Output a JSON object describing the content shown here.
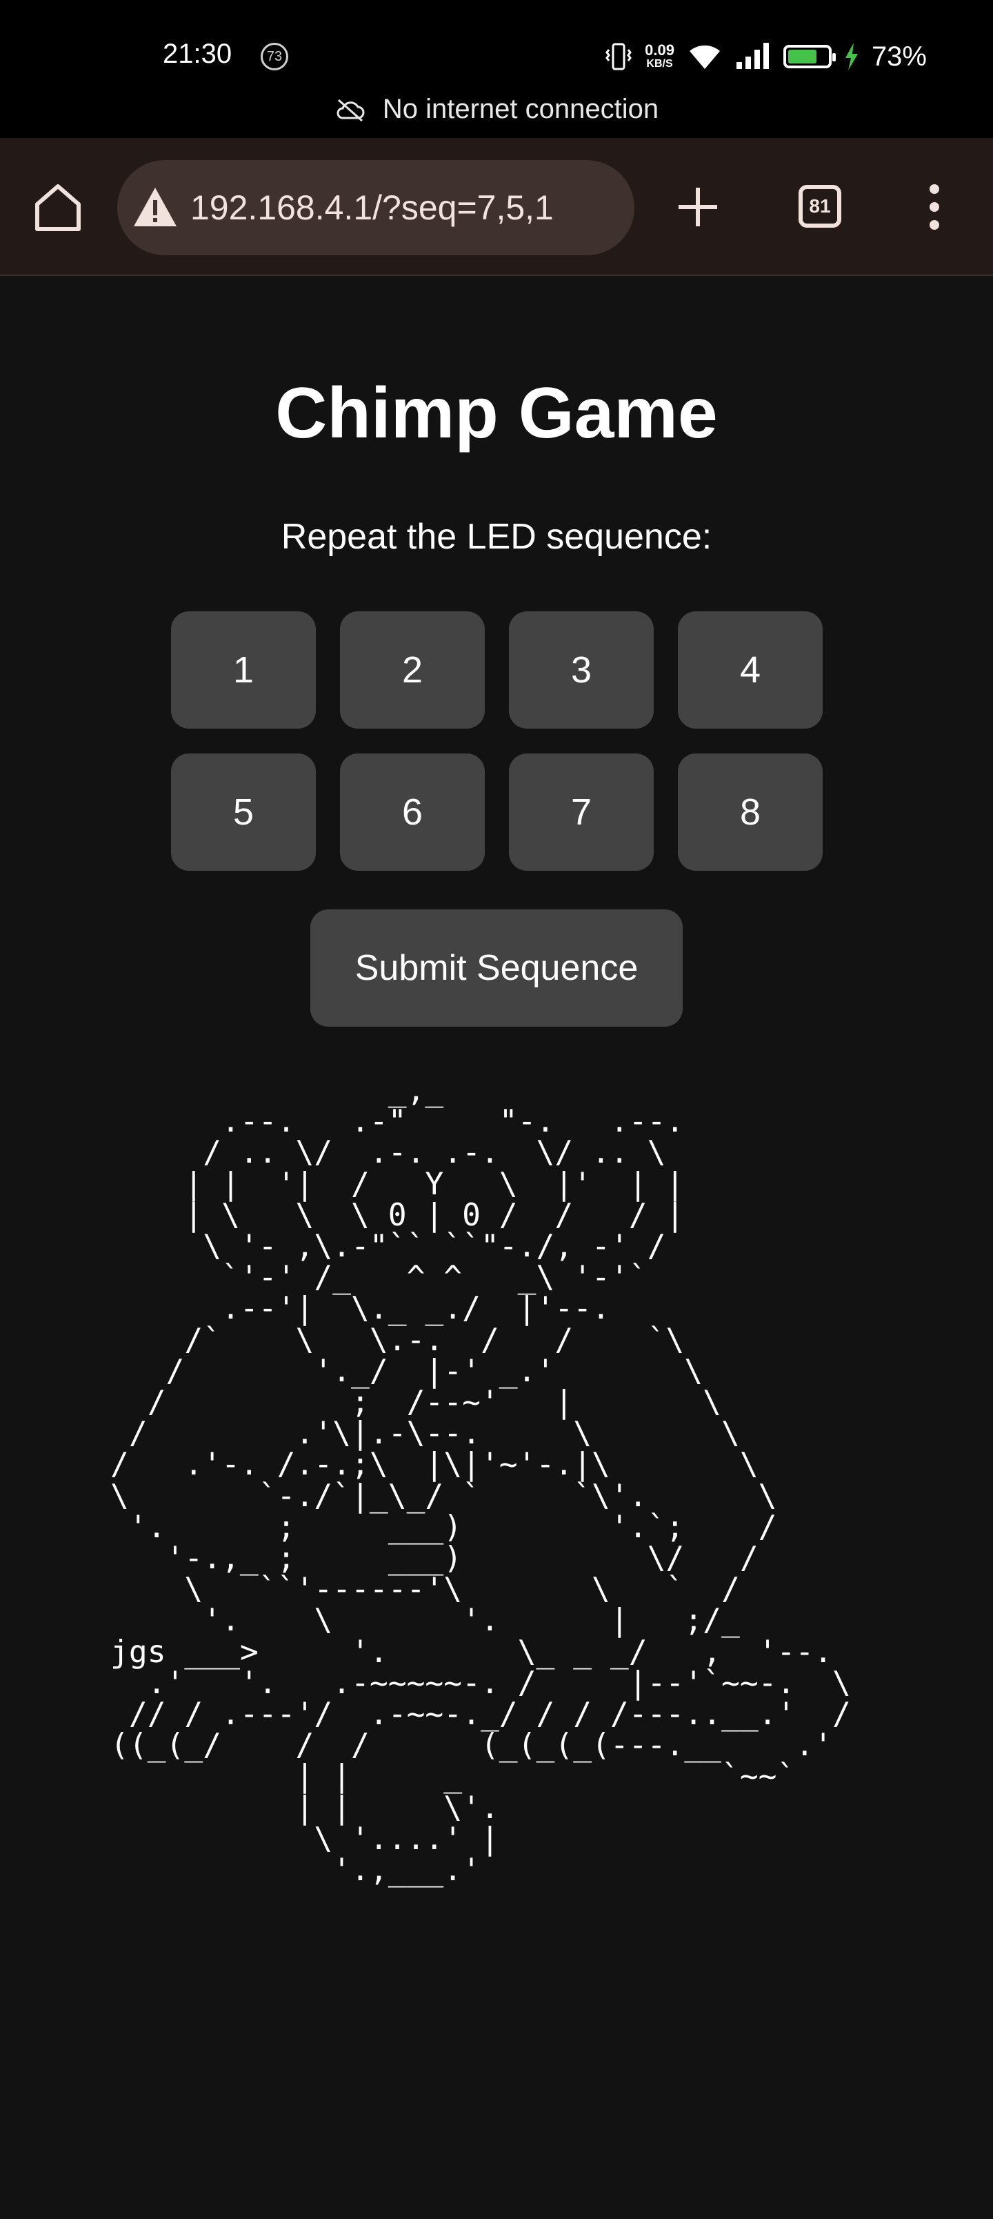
{
  "status_bar": {
    "time": "21:30",
    "notification_count": "73",
    "net_speed": "0.09",
    "net_speed_unit": "KB/S",
    "battery_percent": "73%",
    "battery_level": 0.73,
    "offline_message": "No internet connection"
  },
  "browser": {
    "url": "192.168.4.1/?seq=7,5,1",
    "tab_count": "81",
    "icons": [
      "home-icon",
      "warning-icon",
      "plus-icon",
      "tabs-icon",
      "more-vert-icon"
    ]
  },
  "page": {
    "title": "Chimp Game",
    "instruction": "Repeat the LED sequence:",
    "buttons": [
      "1",
      "2",
      "3",
      "4",
      "5",
      "6",
      "7",
      "8"
    ],
    "submit_label": "Submit Sequence",
    "ascii_art": "               _,_\n      .--.   .-\"     \"-.   .--.\n     / .. \\/  .-. .-.  \\/ .. \\\n    | |  '|  /   Y   \\  |'  | |\n    | \\   \\  \\ 0 | 0 /  /   / |\n     \\ '- ,\\.-\"`` ``\"-./, -' /\n      `'-' /_   ^ ^   _\\ '-'`\n      .--'|  \\._ _./  |'--.\n    /`    \\   \\.-.  /   /    `\\\n   /       '._/  |-' _.'       \\\n  /          ;  /--~'   |       \\\n /        .'\\|.-\\--.     \\       \\\n/   .'-. /.-.;\\  |\\|'~'-.|\\       \\\n\\       `-./`|_\\_/ `     `\\'.      \\\n '.      ;     ___)        '.`;    /\n   '-.,_ ;     ___)          \\/   /\n    \\   ``'------'\\       \\   `  /\n     '.    \\       '.      |   ;/_\njgs ___>     '.       \\_ _ _/   ,  '--.\n  .'   '.   .-~~~~~-. /     |--'`~~-.  \\\n // / .---'/  .-~~-._/ / / /---..__.'  /\n((_(_/    /  /      (_(_(_(---.__    .'\n          | |     _              `~~`\n          | |     \\'.\n           \\ '....' |\n            '.,___.'"
  }
}
